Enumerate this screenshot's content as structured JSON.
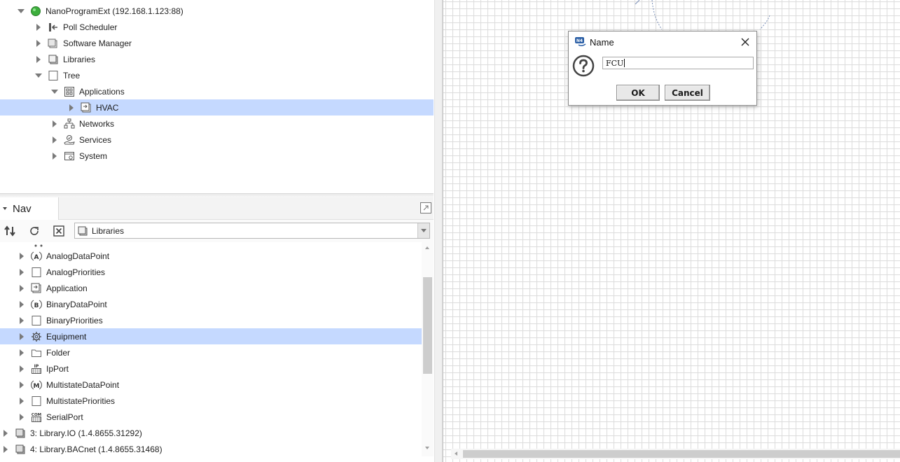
{
  "nav_tree_top": {
    "items": [
      {
        "label": "NanoProgramExt (192.168.1.123:88)",
        "icon": "station-green-icon"
      },
      {
        "label": "Poll Scheduler",
        "icon": "poll-scheduler-icon"
      },
      {
        "label": "Software Manager",
        "icon": "software-manager-icon"
      },
      {
        "label": "Libraries",
        "icon": "libraries-icon"
      },
      {
        "label": "Tree",
        "icon": "folder-icon"
      },
      {
        "label": "Applications",
        "icon": "applications-icon"
      },
      {
        "label": "HVAC",
        "icon": "application-icon"
      },
      {
        "label": "Networks",
        "icon": "networks-icon"
      },
      {
        "label": "Services",
        "icon": "services-icon"
      },
      {
        "label": "System",
        "icon": "system-icon"
      }
    ]
  },
  "nav_panel": {
    "title": "Nav",
    "toolbar": {
      "sync_icon": "sync-icon",
      "refresh_icon": "refresh-icon",
      "close_icon": "close-box-icon"
    },
    "root_selector": {
      "value": "Libraries",
      "icon": "libraries-icon"
    }
  },
  "nav_tree_bottom": {
    "items": [
      {
        "label": "AnalogDataPoint",
        "icon": "analog-datapoint-icon"
      },
      {
        "label": "AnalogPriorities",
        "icon": "blank-component-icon"
      },
      {
        "label": "Application",
        "icon": "application-icon"
      },
      {
        "label": "BinaryDataPoint",
        "icon": "binary-datapoint-icon"
      },
      {
        "label": "BinaryPriorities",
        "icon": "blank-component-icon"
      },
      {
        "label": "Equipment",
        "icon": "gear-icon"
      },
      {
        "label": "Folder",
        "icon": "folder-icon"
      },
      {
        "label": "IpPort",
        "icon": "ip-port-icon"
      },
      {
        "label": "MultistateDataPoint",
        "icon": "multistate-datapoint-icon"
      },
      {
        "label": "MultistatePriorities",
        "icon": "blank-component-icon"
      },
      {
        "label": "SerialPort",
        "icon": "serial-port-icon"
      },
      {
        "label": "3: Library.IO (1.4.8655.31292)",
        "icon": "library-icon"
      },
      {
        "label": "4: Library.BACnet (1.4.8655.31468)",
        "icon": "library-icon"
      }
    ]
  },
  "dialog": {
    "title": "Name",
    "input_value": "FCU",
    "ok_label": "OK",
    "cancel_label": "Cancel"
  },
  "colors": {
    "selection": "#c5d9ff",
    "grid_line": "#dcdcdc",
    "station_green": "#3cae3c"
  }
}
